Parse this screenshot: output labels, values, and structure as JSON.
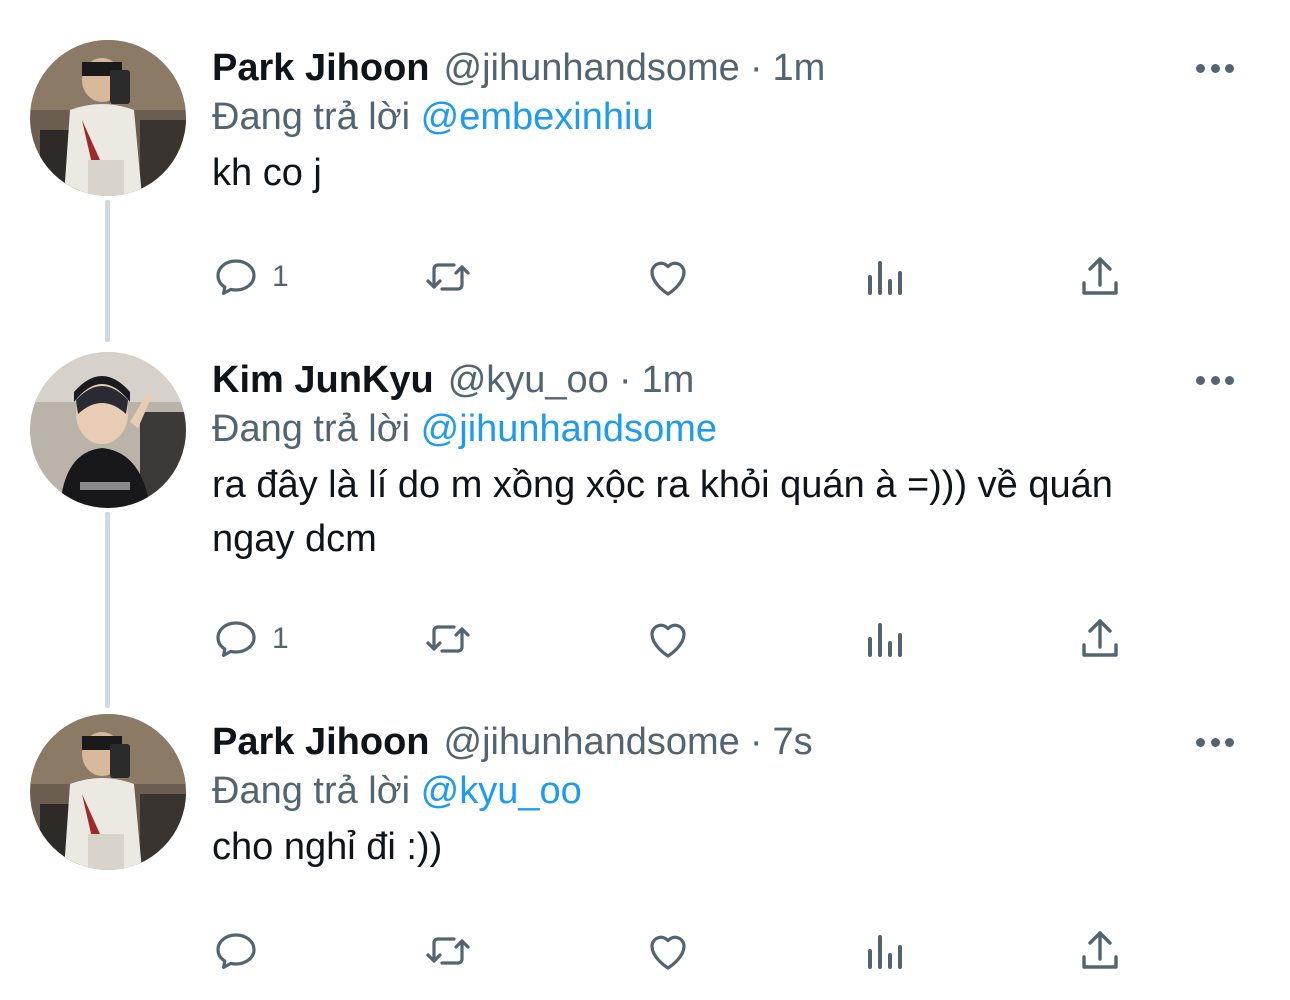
{
  "colors": {
    "text": "#0f1419",
    "secondary": "#536471",
    "accent": "#1d9bf0",
    "thread_line": "#cfd9de"
  },
  "reply_prefix": "Đang trả lời",
  "dot": "·",
  "tweets": [
    {
      "name": "Park Jihoon",
      "handle": "@jihunhandsome",
      "time": "1m",
      "reply_to": "@embexinhiu",
      "text": "kh co j",
      "reply_count": "1",
      "avatar": "avatar-photo-jihoon"
    },
    {
      "name": "Kim JunKyu",
      "handle": "@kyu_oo",
      "time": "1m",
      "reply_to": "@jihunhandsome",
      "text": "ra đây là lí do m xồng xộc ra khỏi quán à =))) về quán ngay dcm",
      "reply_count": "1",
      "avatar": "avatar-photo-junkyu"
    },
    {
      "name": "Park Jihoon",
      "handle": "@jihunhandsome",
      "time": "7s",
      "reply_to": "@kyu_oo",
      "text": "cho nghỉ đi :))",
      "reply_count": "",
      "avatar": "avatar-photo-jihoon"
    }
  ],
  "icons": {
    "reply": "reply-icon",
    "retweet": "retweet-icon",
    "like": "heart-icon",
    "views": "views-icon",
    "share": "share-icon",
    "more": "more-icon"
  }
}
